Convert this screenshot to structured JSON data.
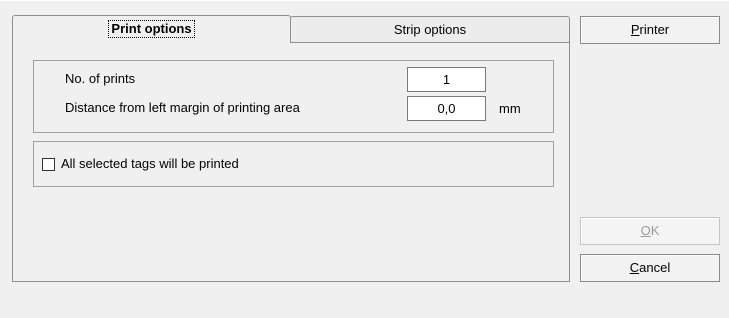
{
  "tabs": {
    "print_options": "Print options",
    "strip_options": "Strip options"
  },
  "print_settings": {
    "no_of_prints_label": "No. of prints",
    "no_of_prints_value": "1",
    "distance_label": "Distance from left margin of printing area",
    "distance_value": "0,0",
    "distance_unit": "mm"
  },
  "options": {
    "all_selected_tags_label": "All selected tags will be printed",
    "all_selected_tags_checked": false
  },
  "buttons": {
    "printer_mnemonic": "P",
    "printer_rest": "rinter",
    "ok_mnemonic": "O",
    "ok_rest": "K",
    "ok_enabled": false,
    "cancel_mnemonic": "C",
    "cancel_rest": "ancel"
  }
}
